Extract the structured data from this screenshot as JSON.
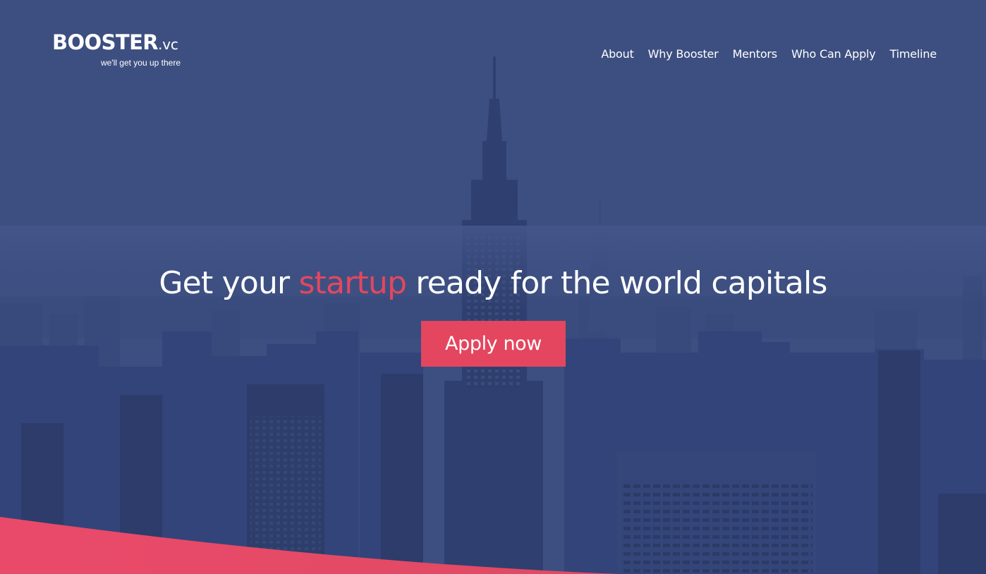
{
  "brand": {
    "name": "BOOSTER",
    "suffix": ".vc",
    "tagline": "we'll get you up there"
  },
  "nav": {
    "items": [
      {
        "label": "About"
      },
      {
        "label": "Why Booster"
      },
      {
        "label": "Mentors"
      },
      {
        "label": "Who Can Apply"
      },
      {
        "label": "Timeline"
      }
    ]
  },
  "hero": {
    "headline_before": "Get your ",
    "headline_highlight": "startup",
    "headline_after": " ready for the world capitals",
    "cta_label": "Apply now",
    "background_image": "new-york-skyline-empire-state-building"
  },
  "colors": {
    "overlay": "#3d4f80",
    "accent": "#e3465e",
    "text": "#ffffff"
  }
}
